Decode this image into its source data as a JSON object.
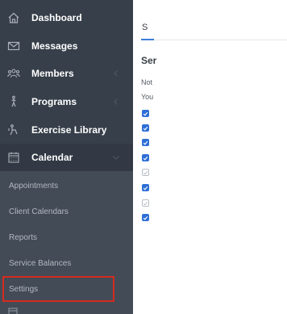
{
  "sidebar": {
    "items": [
      {
        "label": "Dashboard",
        "icon": "home-icon"
      },
      {
        "label": "Messages",
        "icon": "envelope-icon"
      },
      {
        "label": "Members",
        "icon": "users-icon"
      },
      {
        "label": "Programs",
        "icon": "running-icon"
      },
      {
        "label": "Exercise Library",
        "icon": "exercise-icon"
      },
      {
        "label": "Calendar",
        "icon": "calendar-icon"
      }
    ],
    "calendar_sub": [
      {
        "label": "Appointments"
      },
      {
        "label": "Client Calendars"
      },
      {
        "label": "Reports"
      },
      {
        "label": "Service Balances"
      },
      {
        "label": "Settings"
      }
    ]
  },
  "main": {
    "tab_label": "S",
    "heading": "Ser",
    "line1": "Not",
    "line2": "You",
    "checkboxes": [
      true,
      true,
      true,
      true,
      false,
      true,
      false,
      true
    ]
  },
  "colors": {
    "sidebar_bg": "#373f4a",
    "subnav_bg": "#434b56",
    "highlight": "#d42a20",
    "checkbox_on": "#2f6fd6",
    "tab_accent": "#3d7ddb"
  }
}
